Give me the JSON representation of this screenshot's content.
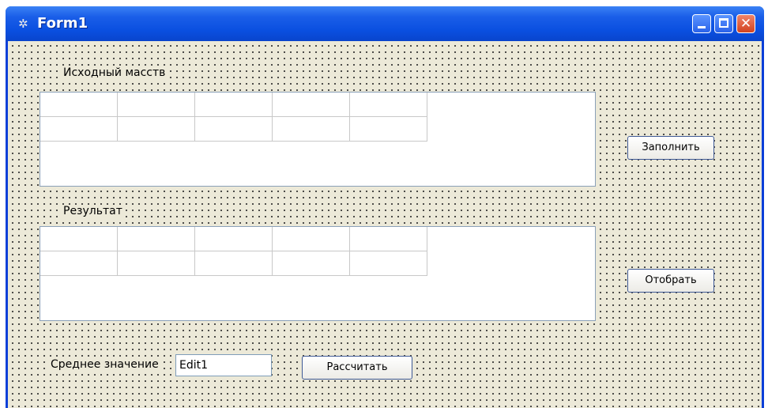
{
  "window": {
    "title": "Form1"
  },
  "labels": {
    "source": "Исходный масств",
    "result": "Результат",
    "average": "Среднее значение"
  },
  "buttons": {
    "fill": "Заполнить",
    "select": "Отобрать",
    "calculate": "Рассчитать"
  },
  "edit": {
    "value": "Edit1"
  },
  "grids": {
    "rows": 2,
    "cols": 5
  }
}
